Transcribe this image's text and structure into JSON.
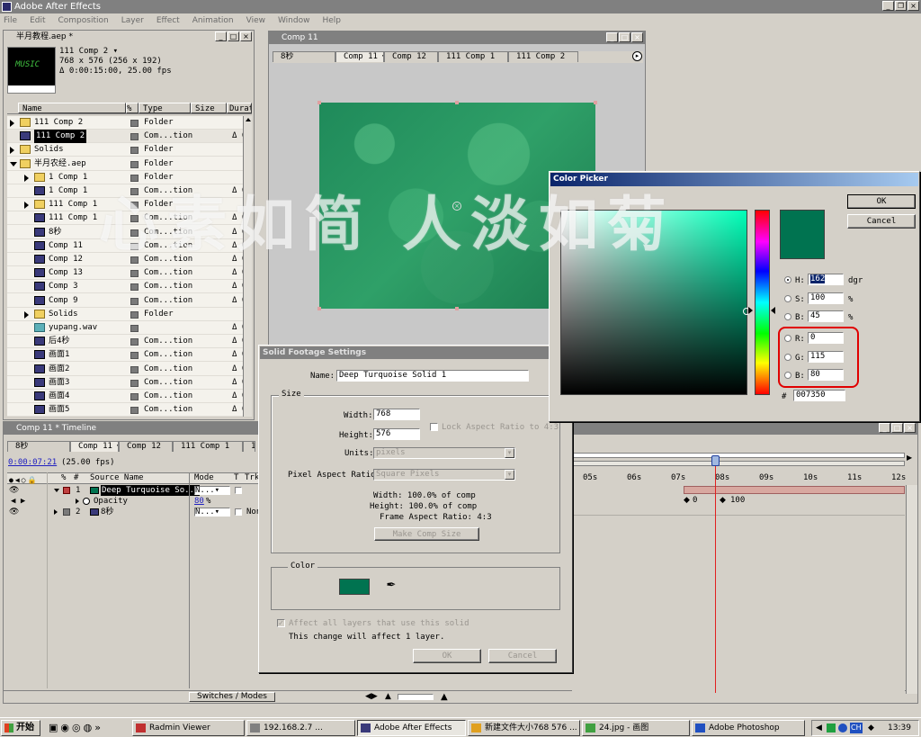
{
  "app": {
    "title": "Adobe After Effects",
    "menu": [
      "File",
      "Edit",
      "Composition",
      "Layer",
      "Effect",
      "Animation",
      "View",
      "Window",
      "Help"
    ]
  },
  "project": {
    "title": "半月教程.aep *",
    "thumb_text": "MUSIC",
    "info": {
      "name": "111 Comp 2 ▾",
      "dims": "768 x 576  (256 x 192)",
      "duration": "Δ 0:00:15:00, 25.00 fps"
    },
    "columns": [
      "Name",
      "Type",
      "Size",
      "Durati"
    ],
    "items": [
      {
        "name": "111 Comp 2",
        "type": "Folder",
        "dur": "",
        "kind": "folder",
        "indent": 0,
        "tri": "closed"
      },
      {
        "name": "111 Comp 2",
        "type": "Com...tion",
        "dur": "Δ 0",
        "kind": "comp",
        "indent": 0,
        "tri": "none",
        "selected": true
      },
      {
        "name": "Solids",
        "type": "Folder",
        "dur": "",
        "kind": "folder",
        "indent": 0,
        "tri": "closed"
      },
      {
        "name": "半月农经.aep",
        "type": "Folder",
        "dur": "",
        "kind": "folder",
        "indent": 0,
        "tri": "open"
      },
      {
        "name": "1 Comp 1",
        "type": "Folder",
        "dur": "",
        "kind": "folder",
        "indent": 1,
        "tri": "closed"
      },
      {
        "name": "1 Comp 1",
        "type": "Com...tion",
        "dur": "Δ 0",
        "kind": "comp",
        "indent": 1,
        "tri": "none"
      },
      {
        "name": "111 Comp 1",
        "type": "Folder",
        "dur": "",
        "kind": "folder",
        "indent": 1,
        "tri": "closed"
      },
      {
        "name": "111 Comp 1",
        "type": "Com...tion",
        "dur": "Δ 0",
        "kind": "comp",
        "indent": 1,
        "tri": "none"
      },
      {
        "name": "8秒",
        "type": "Com...tion",
        "dur": "Δ 0",
        "kind": "comp",
        "indent": 1,
        "tri": "none"
      },
      {
        "name": "Comp 11",
        "type": "Com...tion",
        "dur": "Δ 0",
        "kind": "comp",
        "indent": 1,
        "tri": "none"
      },
      {
        "name": "Comp 12",
        "type": "Com...tion",
        "dur": "Δ 0",
        "kind": "comp",
        "indent": 1,
        "tri": "none"
      },
      {
        "name": "Comp 13",
        "type": "Com...tion",
        "dur": "Δ 0",
        "kind": "comp",
        "indent": 1,
        "tri": "none"
      },
      {
        "name": "Comp 3",
        "type": "Com...tion",
        "dur": "Δ 0",
        "kind": "comp",
        "indent": 1,
        "tri": "none"
      },
      {
        "name": "Comp 9",
        "type": "Com...tion",
        "dur": "Δ 0",
        "kind": "comp",
        "indent": 1,
        "tri": "none"
      },
      {
        "name": "Solids",
        "type": "Folder",
        "dur": "",
        "kind": "folder",
        "indent": 1,
        "tri": "closed"
      },
      {
        "name": "yupang.wav",
        "type": "",
        "dur": "Δ 0",
        "kind": "audio",
        "indent": 1,
        "tri": "none"
      },
      {
        "name": "后4秒",
        "type": "Com...tion",
        "dur": "Δ 0",
        "kind": "comp",
        "indent": 1,
        "tri": "none"
      },
      {
        "name": "画面1",
        "type": "Com...tion",
        "dur": "Δ 0",
        "kind": "comp",
        "indent": 1,
        "tri": "none"
      },
      {
        "name": "画面2",
        "type": "Com...tion",
        "dur": "Δ 0",
        "kind": "comp",
        "indent": 1,
        "tri": "none"
      },
      {
        "name": "画面3",
        "type": "Com...tion",
        "dur": "Δ 0",
        "kind": "comp",
        "indent": 1,
        "tri": "none"
      },
      {
        "name": "画面4",
        "type": "Com...tion",
        "dur": "Δ 0",
        "kind": "comp",
        "indent": 1,
        "tri": "none"
      },
      {
        "name": "画面5",
        "type": "Com...tion",
        "dur": "Δ 0",
        "kind": "comp",
        "indent": 1,
        "tri": "none"
      }
    ]
  },
  "comp_window": {
    "title": "Comp 11",
    "tabs": [
      "8秒",
      "Comp 11 ┛",
      "Comp 12",
      "111 Comp 1",
      "111 Comp 2"
    ]
  },
  "timeline": {
    "title": "Comp 11 * Timeline",
    "tabs": [
      "8秒",
      "Comp 11 ┛",
      "Comp 12",
      "111 Comp 1",
      "11"
    ],
    "timecode": "0:00:07:21",
    "fps": "(25.00 fps)",
    "headers": {
      "source": "Source Name",
      "mode": "Mode",
      "t": "T",
      "trkmat": "TrkM"
    },
    "layers": [
      {
        "num": "1",
        "name": "Deep Turquoise So...",
        "mode": "N...▾",
        "extra": ""
      },
      {
        "prop": "Opacity",
        "value": "80",
        "unit": "%"
      },
      {
        "num": "2",
        "name": "8秒",
        "mode": "N...▾",
        "extra": "Non"
      }
    ],
    "switches_label": "Switches / Modes",
    "ruler": [
      "05s",
      "06s",
      "07s",
      "08s",
      "09s",
      "10s",
      "11s",
      "12s"
    ],
    "keyframes": [
      "0",
      "100"
    ]
  },
  "solid_dialog": {
    "title": "Solid Footage Settings",
    "name_label": "Name:",
    "name_value": "Deep Turquoise Solid 1",
    "size_group": "Size",
    "width_label": "Width:",
    "width_value": "768",
    "height_label": "Height:",
    "height_value": "576",
    "lock_label": "Lock Aspect Ratio to 4:3",
    "units_label": "Units:",
    "units_value": "pixels",
    "par_label": "Pixel Aspect Ratio:",
    "par_value": "Square Pixels",
    "info_width": "Width:  100.0% of comp",
    "info_height": "Height:  100.0% of comp",
    "info_frame": "Frame Aspect Ratio: 4:3",
    "make_comp": "Make Comp Size",
    "color_group": "Color",
    "swatch_color": "#007350",
    "affect_label": "Affect all layers that use this solid",
    "affect_note": "This change will affect 1 layer.",
    "ok": "OK",
    "cancel": "Cancel"
  },
  "color_picker": {
    "title": "Color Picker",
    "ok": "OK",
    "cancel": "Cancel",
    "h_label": "H:",
    "h_value": "162",
    "h_unit": "dgr",
    "s_label": "S:",
    "s_value": "100",
    "s_unit": "%",
    "b_label": "B:",
    "b_value": "45",
    "b_unit": "%",
    "r_label": "R:",
    "r_value": "0",
    "g_label": "G:",
    "g_value": "115",
    "bb_label": "B:",
    "bb_value": "80",
    "hex_label": "#",
    "hex_value": "007350",
    "current_color": "#007350",
    "field_hue": "#00ffb8"
  },
  "watermark": "心素如简 人淡如菊",
  "taskbar": {
    "start": "开始",
    "items": [
      "Radmin Viewer",
      "192.168.2.7 ...",
      "Adobe After Effects",
      "新建文件大小768 576 ...",
      "24.jpg - 画图",
      "Adobe Photoshop"
    ],
    "tray_ch": "CH",
    "clock": "13:39"
  }
}
